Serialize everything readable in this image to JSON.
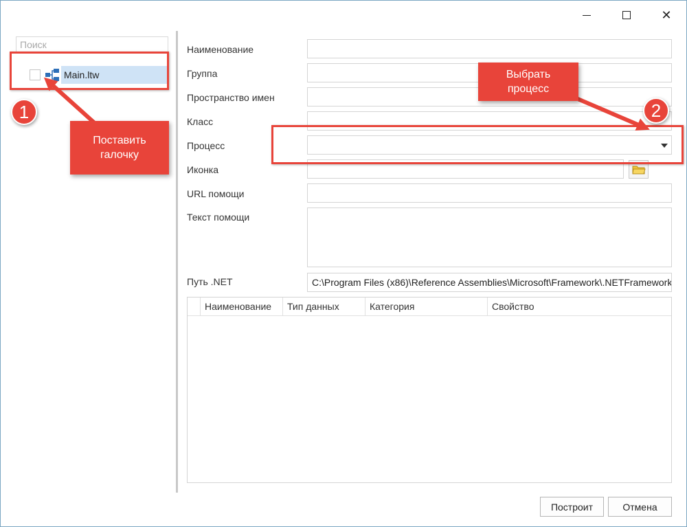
{
  "window": {
    "controls": {
      "minimize": "",
      "maximize": "",
      "close": "✕"
    }
  },
  "left_panel": {
    "search": {
      "placeholder": "Поиск",
      "value": ""
    },
    "tree": [
      {
        "label": "Main.ltw",
        "checked": false,
        "icon": "process-diagram-icon"
      }
    ]
  },
  "form": {
    "fields": {
      "name": {
        "label": "Наименование",
        "value": ""
      },
      "group": {
        "label": "Группа",
        "value": ""
      },
      "namespace": {
        "label": "Пространство имен",
        "value": ""
      },
      "class": {
        "label": "Класс",
        "value": ""
      },
      "process": {
        "label": "Процесс",
        "value": ""
      },
      "icon": {
        "label": "Иконка",
        "value": ""
      },
      "help_url": {
        "label": "URL помощи",
        "value": ""
      },
      "help_text": {
        "label": "Текст помощи",
        "value": ""
      },
      "net_path": {
        "label": "Путь .NET",
        "value": "C:\\Program Files (x86)\\Reference Assemblies\\Microsoft\\Framework\\.NETFramework"
      }
    },
    "grid": {
      "columns": [
        "Наименование",
        "Тип данных",
        "Категория",
        "Свойство"
      ],
      "rows": []
    }
  },
  "buttons": {
    "build": "Построит",
    "cancel": "Отмена"
  },
  "annotations": {
    "step1": {
      "number": "1",
      "text_line1": "Поставить",
      "text_line2": "галочку"
    },
    "step2": {
      "number": "2",
      "text_line1": "Выбрать",
      "text_line2": "процесс"
    },
    "color": "#e8443a"
  },
  "colors": {
    "selection": "#cfe3f6",
    "border": "#d4d4d4",
    "window_border": "#7aa6c2"
  }
}
